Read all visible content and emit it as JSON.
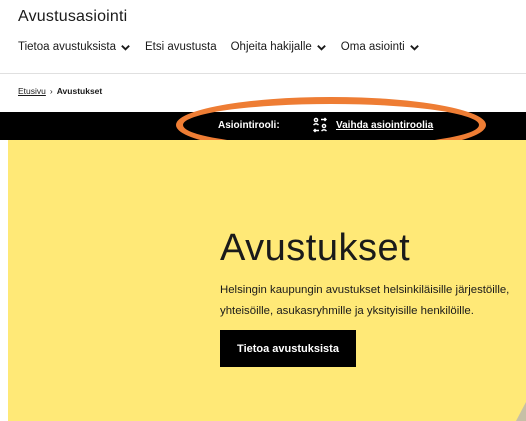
{
  "header": {
    "site_title": "Avustusasiointi"
  },
  "nav": {
    "items": [
      {
        "label": "Tietoa avustuksista",
        "has_dropdown": true
      },
      {
        "label": "Etsi avustusta",
        "has_dropdown": false
      },
      {
        "label": "Ohjeita hakijalle",
        "has_dropdown": true
      },
      {
        "label": "Oma asiointi",
        "has_dropdown": true
      }
    ]
  },
  "breadcrumb": {
    "home": "Etusivu",
    "separator": "›",
    "current": "Avustukset"
  },
  "role_bar": {
    "label": "Asiointirooli:",
    "switch_label": "Vaihda asiointiroolia",
    "switch_icon": "swap-arrows-icon"
  },
  "hero": {
    "title": "Avustukset",
    "description": "Helsingin kaupungin avustukset helsinkiläisille järjestöille, yhteisöille, asukasryhmille ja yksityisille henkilöille.",
    "button_label": "Tietoa avustuksista"
  },
  "colors": {
    "hero_background": "#ffe977",
    "role_bar_background": "#000000",
    "highlight_ring": "#ee7d34"
  }
}
